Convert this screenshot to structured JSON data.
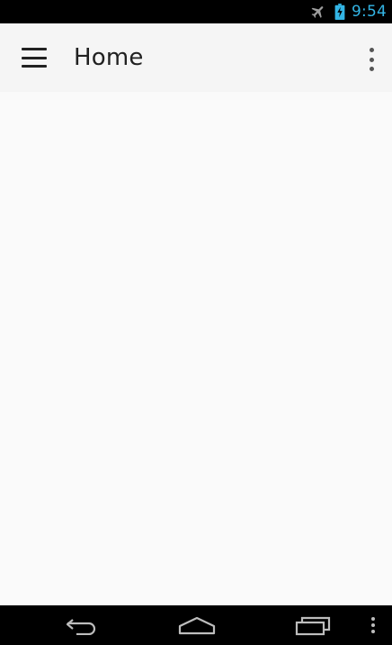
{
  "status_bar": {
    "time": "9:54",
    "icons": [
      "airplane-mode-icon",
      "battery-charging-icon"
    ],
    "time_color": "#33b5e5"
  },
  "toolbar": {
    "title": "Home",
    "background": "#f5f5f5",
    "icons": [
      "hamburger-menu-icon",
      "overflow-menu-icon"
    ]
  },
  "nav_bar": {
    "icons": [
      "back-icon",
      "home-icon",
      "recents-icon",
      "menu-icon"
    ]
  }
}
